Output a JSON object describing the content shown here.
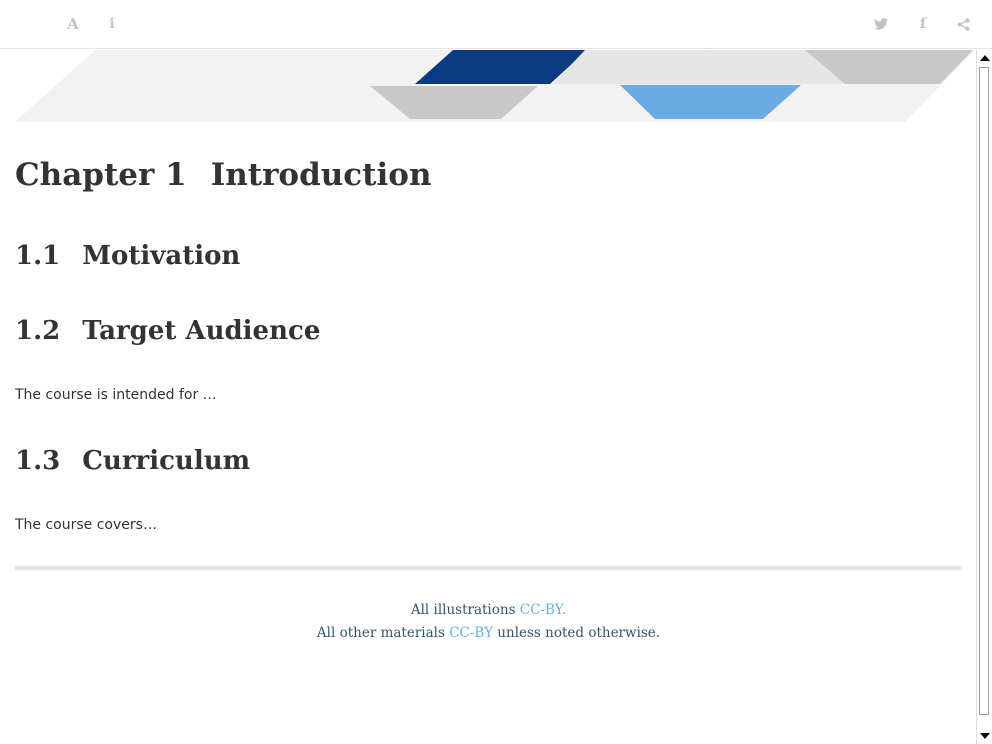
{
  "toolbar": {
    "left_icons": [
      "font-settings-icon",
      "info-icon"
    ],
    "right_icons": [
      "twitter-icon",
      "facebook-icon",
      "share-icon"
    ],
    "font_glyph": "A",
    "info_glyph": "i",
    "facebook_glyph": "f"
  },
  "banner": {
    "colors": {
      "dark_blue": "#0a3a82",
      "light_blue": "#6aabe4",
      "mid_gray": "#c8c8c8",
      "light_gray": "#e6e6e6",
      "faint_gray": "#f2f2f2"
    }
  },
  "chapter": {
    "number": "Chapter 1",
    "title": "Introduction"
  },
  "sections": [
    {
      "number": "1.1",
      "title": "Motivation",
      "text": ""
    },
    {
      "number": "1.2",
      "title": "Target Audience",
      "text": "The course is intended for …"
    },
    {
      "number": "1.3",
      "title": "Curriculum",
      "text": "The course covers…"
    }
  ],
  "footer": {
    "line1_prefix": "All illustrations ",
    "line1_link": "CC-BY.",
    "line2_prefix": "All other materials ",
    "line2_link": "CC-BY",
    "line2_suffix": " unless noted otherwise."
  },
  "colors": {
    "link": "#6ab0de",
    "footer_text": "#33556b",
    "heading": "#333333",
    "toolbar_icon": "#c2c2c2"
  }
}
